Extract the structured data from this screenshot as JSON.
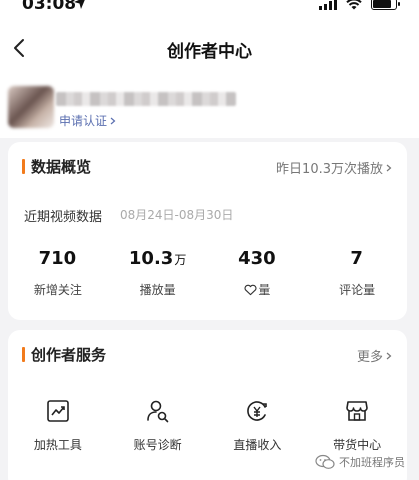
{
  "status": {
    "time": "03:08"
  },
  "nav": {
    "title": "创作者中心"
  },
  "profile": {
    "certify_label": "申请认证"
  },
  "data_overview": {
    "title": "数据概览",
    "more_label": "昨日10.3万次播放",
    "range_label": "近期视频数据",
    "range_dates": "08月24日-08月30日",
    "stats": [
      {
        "value": "710",
        "unit": "",
        "label": "新增关注"
      },
      {
        "value": "10.3",
        "unit": "万",
        "label": "播放量"
      },
      {
        "value": "430",
        "unit": "",
        "label": "量",
        "icon": "heart-icon"
      },
      {
        "value": "7",
        "unit": "",
        "label": "评论量"
      }
    ]
  },
  "creator_services": {
    "title": "创作者服务",
    "more_label": "更多",
    "tools": [
      {
        "label": "加热工具",
        "icon": "trend-chart-icon"
      },
      {
        "label": "账号诊断",
        "icon": "account-diagnosis-icon"
      },
      {
        "label": "直播收入",
        "icon": "live-income-icon"
      },
      {
        "label": "带货中心",
        "icon": "store-icon"
      }
    ]
  },
  "watermark": {
    "text": "不加班程序员"
  },
  "colors": {
    "accent": "#f27b1c",
    "link": "#5b6fb0"
  }
}
